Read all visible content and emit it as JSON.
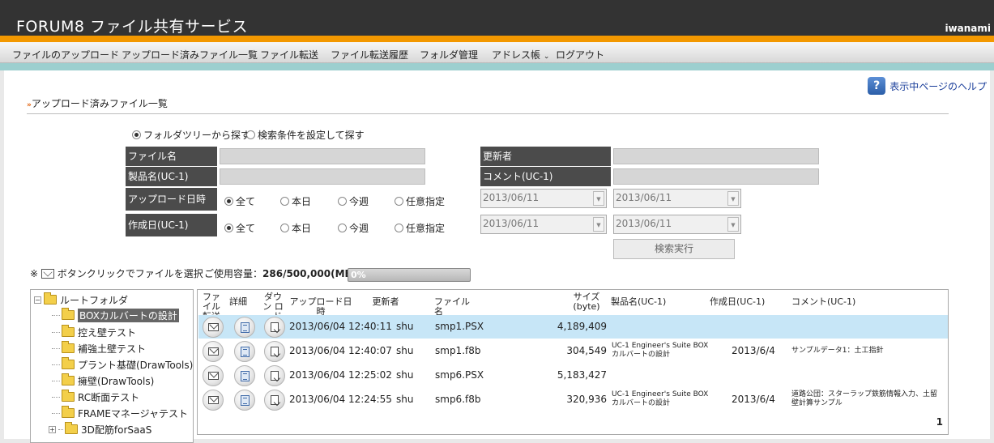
{
  "header": {
    "title": "FORUM8 ファイル共有サービス",
    "user": "iwanami"
  },
  "menu": [
    {
      "label": "ファイルのアップロード"
    },
    {
      "label": "アップロード済みファイル一覧"
    },
    {
      "label": "ファイル転送"
    },
    {
      "label": "ファイル転送履歴"
    },
    {
      "label": "フォルダ管理"
    },
    {
      "label": "アドレス帳",
      "caret": "⌄"
    },
    {
      "label": "ログアウト"
    }
  ],
  "help": {
    "label": "表示中ページのヘルプ",
    "icon": "question-icon"
  },
  "page": {
    "marker": "»",
    "title": "アップロード済みファイル一覧"
  },
  "search_mode": {
    "selected": "folder",
    "options": [
      "フォルダツリーから探す",
      "検索条件を設定して探す"
    ]
  },
  "form": {
    "file_name_label": "ファイル名",
    "product_label": "製品名(UC-1)",
    "upload_date_label": "アップロード日時",
    "created_label": "作成日(UC-1)",
    "updater_label": "更新者",
    "comment_label": "コメント(UC-1)",
    "date_options": [
      "全て",
      "本日",
      "今週",
      "任意指定"
    ],
    "date_values": [
      "2013/06/11",
      "2013/06/11",
      "2013/06/11",
      "2013/06/11"
    ],
    "search_button": "検索実行"
  },
  "strip": {
    "prefix": "※",
    "instruction": "ボタンクリックでファイルを選択",
    "usage_label": "ご使用容量：",
    "usage_value": "286/500,000(MB)",
    "progress_text": "0%",
    "progress_fraction": 0.0
  },
  "tree": {
    "expander": "−",
    "collapsed_expander": "+",
    "root": "ルートフォルダ",
    "items": [
      "BOXカルバートの設計",
      "控え壁テスト",
      "補強土壁テスト",
      "プラント基礎(DrawTools)",
      "擁壁(DrawTools)",
      "RC断面テスト",
      "FRAMEマネージャテスト",
      "3D配筋forSaaS"
    ],
    "selected_index": 0
  },
  "table": {
    "headers": {
      "transfer": "ファイル 転送",
      "detail": "詳細",
      "download": "ダウン ロード",
      "uploaded": "アップロード日時",
      "updater": "更新者",
      "file": "ファイル名",
      "size": "サイズ (byte)",
      "product": "製品名(UC-1)",
      "created": "作成日(UC-1)",
      "comment": "コメント(UC-1)"
    },
    "rows": [
      {
        "uploaded": "2013/06/04 12:40:11",
        "updater": "shu",
        "file": "smp1.PSX",
        "size": "4,189,409",
        "product": "",
        "created": "",
        "comment": ""
      },
      {
        "uploaded": "2013/06/04 12:40:07",
        "updater": "shu",
        "file": "smp1.f8b",
        "size": "304,549",
        "product": "UC-1 Engineer's Suite BOXカルバートの設計",
        "created": "2013/6/4",
        "comment": "サンプルデータ1：土工指針"
      },
      {
        "uploaded": "2013/06/04 12:25:02",
        "updater": "shu",
        "file": "smp6.PSX",
        "size": "5,183,427",
        "product": "",
        "created": "",
        "comment": ""
      },
      {
        "uploaded": "2013/06/04 12:24:55",
        "updater": "shu",
        "file": "smp6.f8b",
        "size": "320,936",
        "product": "UC-1 Engineer's Suite BOXカルバートの設計",
        "created": "2013/6/4",
        "comment": "道路公団：スターラップ鉄筋情報入力、土留壁計算サンプル"
      }
    ],
    "selected_row": 0,
    "page": "1"
  },
  "colors": {
    "accent": "#f39800",
    "topbar": "#333333",
    "teal": "#9ccfcf",
    "label_bg": "#4b4b4b",
    "selected_row": "#c7e6f7"
  }
}
